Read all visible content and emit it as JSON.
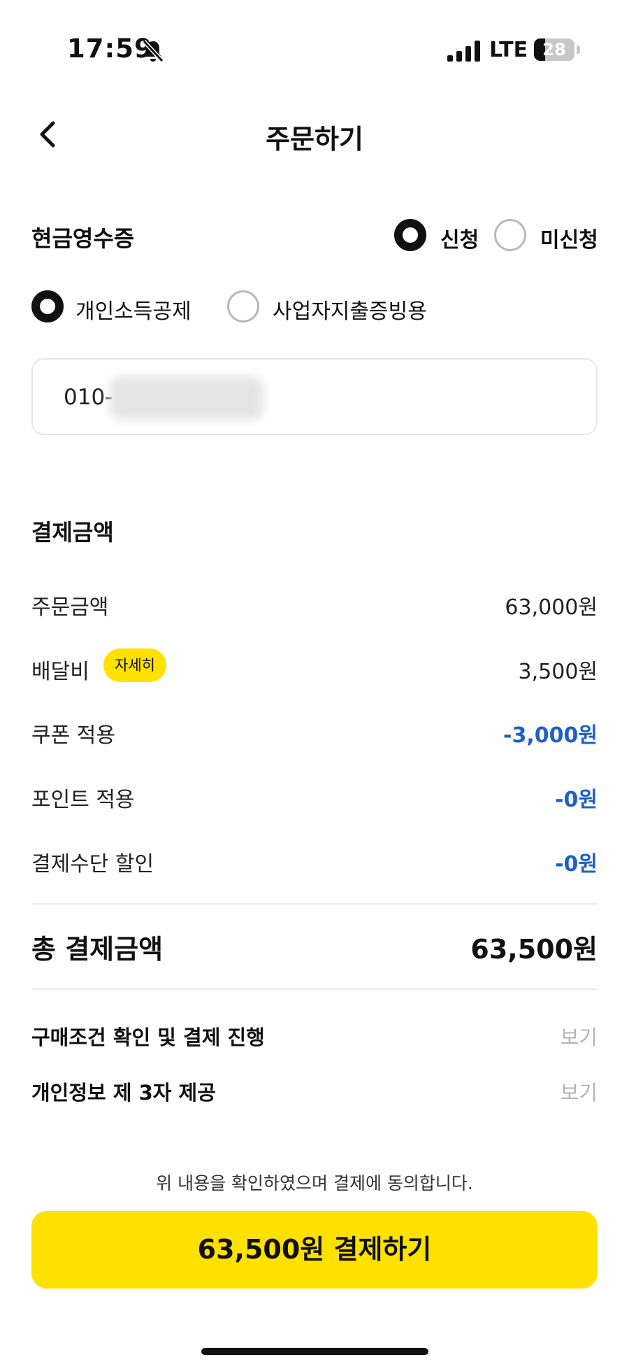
{
  "status_bar": {
    "time": "17:59",
    "network": "LTE",
    "battery": "28",
    "battery_level": 0.28
  },
  "header": {
    "title": "주문하기"
  },
  "cash_receipt": {
    "label": "현금영수증",
    "options": [
      "신청",
      "미신청"
    ],
    "selected_option": "신청",
    "types": [
      "개인소득공제",
      "사업자지출증빙용"
    ],
    "selected_type": "개인소득공제",
    "phone_prefix": "010-"
  },
  "payment_amount": {
    "label": "결제금액",
    "rows": [
      {
        "label": "주문금액",
        "value": "63,000원"
      },
      {
        "label": "배달비",
        "value": "3,500원",
        "badge": "자세히"
      },
      {
        "label": "쿠폰 적용",
        "value": "-3,000원"
      },
      {
        "label": "포인트 적용",
        "value": "-0원"
      },
      {
        "label": "결제수단 할인",
        "value": "-0원"
      }
    ],
    "total_label": "총 결제금액",
    "total_value": "63,500원"
  },
  "terms": [
    {
      "label": "구매조건 확인 및 결제 진행",
      "action": "보기"
    },
    {
      "label": "개인정보 제 3자 제공",
      "action": "보기"
    }
  ],
  "agreement_text": "위 내용을 확인하였으며 결제에 동의합니다.",
  "pay_button": "63,500원 결제하기",
  "colors": {
    "accent": "#ffe100",
    "discount": "#1f5fc6",
    "muted": "#b5b5b5"
  },
  "icons": {
    "back": "chevron-left-icon",
    "silent": "bell-off-icon"
  }
}
